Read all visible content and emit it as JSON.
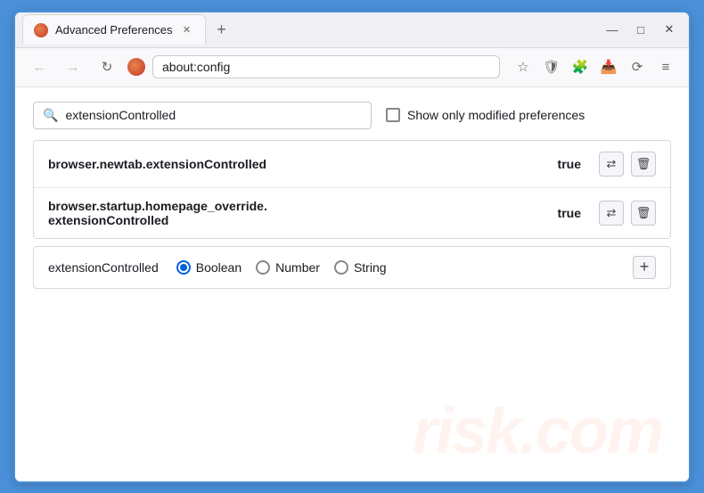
{
  "browser": {
    "tab_title": "Advanced Preferences",
    "new_tab_icon": "+",
    "address": "about:config",
    "firefox_label": "Firefox"
  },
  "window_controls": {
    "minimize": "—",
    "maximize": "□",
    "close": "✕"
  },
  "nav": {
    "back": "←",
    "forward": "→",
    "refresh": "↻",
    "bookmark": "☆",
    "shield": "🛡",
    "extension": "🧩",
    "download": "📥",
    "menu": "≡"
  },
  "search": {
    "placeholder": "extensionControlled",
    "value": "extensionControlled",
    "show_modified_label": "Show only modified preferences"
  },
  "results": [
    {
      "name": "browser.newtab.extensionControlled",
      "value": "true"
    },
    {
      "name_line1": "browser.startup.homepage_override.",
      "name_line2": "extensionControlled",
      "value": "true"
    }
  ],
  "add_row": {
    "name": "extensionControlled",
    "types": [
      {
        "label": "Boolean",
        "selected": true
      },
      {
        "label": "Number",
        "selected": false
      },
      {
        "label": "String",
        "selected": false
      }
    ],
    "add_btn": "+"
  },
  "watermark": "risk.com"
}
